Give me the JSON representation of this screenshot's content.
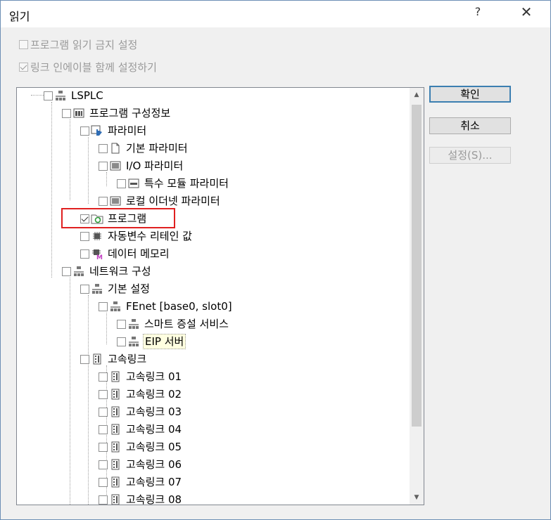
{
  "window": {
    "title": "읽기",
    "help_glyph": "?",
    "close_glyph": "✕"
  },
  "options": {
    "read_protect": {
      "label": "프로그램 읽기 금지 설정",
      "checked": false
    },
    "link_enable": {
      "label": "링크 인에이블 함께 설정하기",
      "checked": true
    }
  },
  "buttons": {
    "ok": "확인",
    "cancel": "취소",
    "settings": "설정(S)..."
  },
  "tree": {
    "items": [
      {
        "label": "LSPLC",
        "icon": "network-icon",
        "checked": false
      },
      {
        "label": "프로그램 구성정보",
        "icon": "project-config-icon",
        "checked": false
      },
      {
        "label": "파라미터",
        "icon": "parameter-icon",
        "checked": false
      },
      {
        "label": "기본 파라미터",
        "icon": "document-icon",
        "checked": false
      },
      {
        "label": "I/O 파라미터",
        "icon": "grid-icon",
        "checked": false
      },
      {
        "label": "특수 모듈 파라미터",
        "icon": "module-icon",
        "checked": false
      },
      {
        "label": "로컬 이더넷 파라미터",
        "icon": "grid-icon",
        "checked": false
      },
      {
        "label": "프로그램",
        "icon": "program-folder-icon",
        "checked": true
      },
      {
        "label": "자동변수 리테인 값",
        "icon": "chip-icon",
        "checked": false
      },
      {
        "label": "데이터 메모리",
        "icon": "memory-icon",
        "checked": false
      },
      {
        "label": "네트워크 구성",
        "icon": "network-icon",
        "checked": false
      },
      {
        "label": "기본 설정",
        "icon": "network-icon",
        "checked": false
      },
      {
        "label": "FEnet [base0, slot0]",
        "icon": "network-icon",
        "checked": false
      },
      {
        "label": "스마트 증설 서비스",
        "icon": "network-icon",
        "checked": false
      },
      {
        "label": "EIP 서버",
        "icon": "network-icon",
        "checked": false,
        "selected": true
      },
      {
        "label": "고속링크",
        "icon": "highspeed-link-icon",
        "checked": false
      },
      {
        "label": "고속링크 01",
        "icon": "highspeed-link-icon",
        "checked": false
      },
      {
        "label": "고속링크 02",
        "icon": "highspeed-link-icon",
        "checked": false
      },
      {
        "label": "고속링크 03",
        "icon": "highspeed-link-icon",
        "checked": false
      },
      {
        "label": "고속링크 04",
        "icon": "highspeed-link-icon",
        "checked": false
      },
      {
        "label": "고속링크 05",
        "icon": "highspeed-link-icon",
        "checked": false
      },
      {
        "label": "고속링크 06",
        "icon": "highspeed-link-icon",
        "checked": false
      },
      {
        "label": "고속링크 07",
        "icon": "highspeed-link-icon",
        "checked": false
      },
      {
        "label": "고속링크 08",
        "icon": "highspeed-link-icon",
        "checked": false
      }
    ]
  },
  "colors": {
    "highlight_box": "#e02020",
    "selection_bg": "#ffffe0",
    "default_button_border": "#3c7fb1"
  }
}
